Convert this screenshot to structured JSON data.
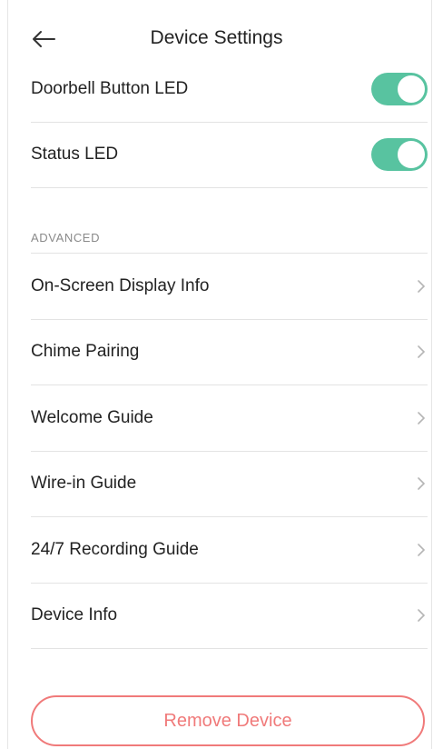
{
  "header": {
    "title": "Device Settings",
    "back_icon": "arrow-left-icon"
  },
  "toggles": [
    {
      "label": "Doorbell Button LED",
      "on": true
    },
    {
      "label": "Status LED",
      "on": true
    }
  ],
  "colors": {
    "accent": "#58c3a0",
    "danger": "#f07a7a"
  },
  "advanced": {
    "section_label": "ADVANCED",
    "items": [
      {
        "label": "On-Screen Display Info"
      },
      {
        "label": "Chime Pairing"
      },
      {
        "label": "Welcome Guide"
      },
      {
        "label": "Wire-in Guide"
      },
      {
        "label": "24/7 Recording Guide"
      },
      {
        "label": "Device Info"
      }
    ]
  },
  "footer": {
    "remove_label": "Remove Device"
  }
}
